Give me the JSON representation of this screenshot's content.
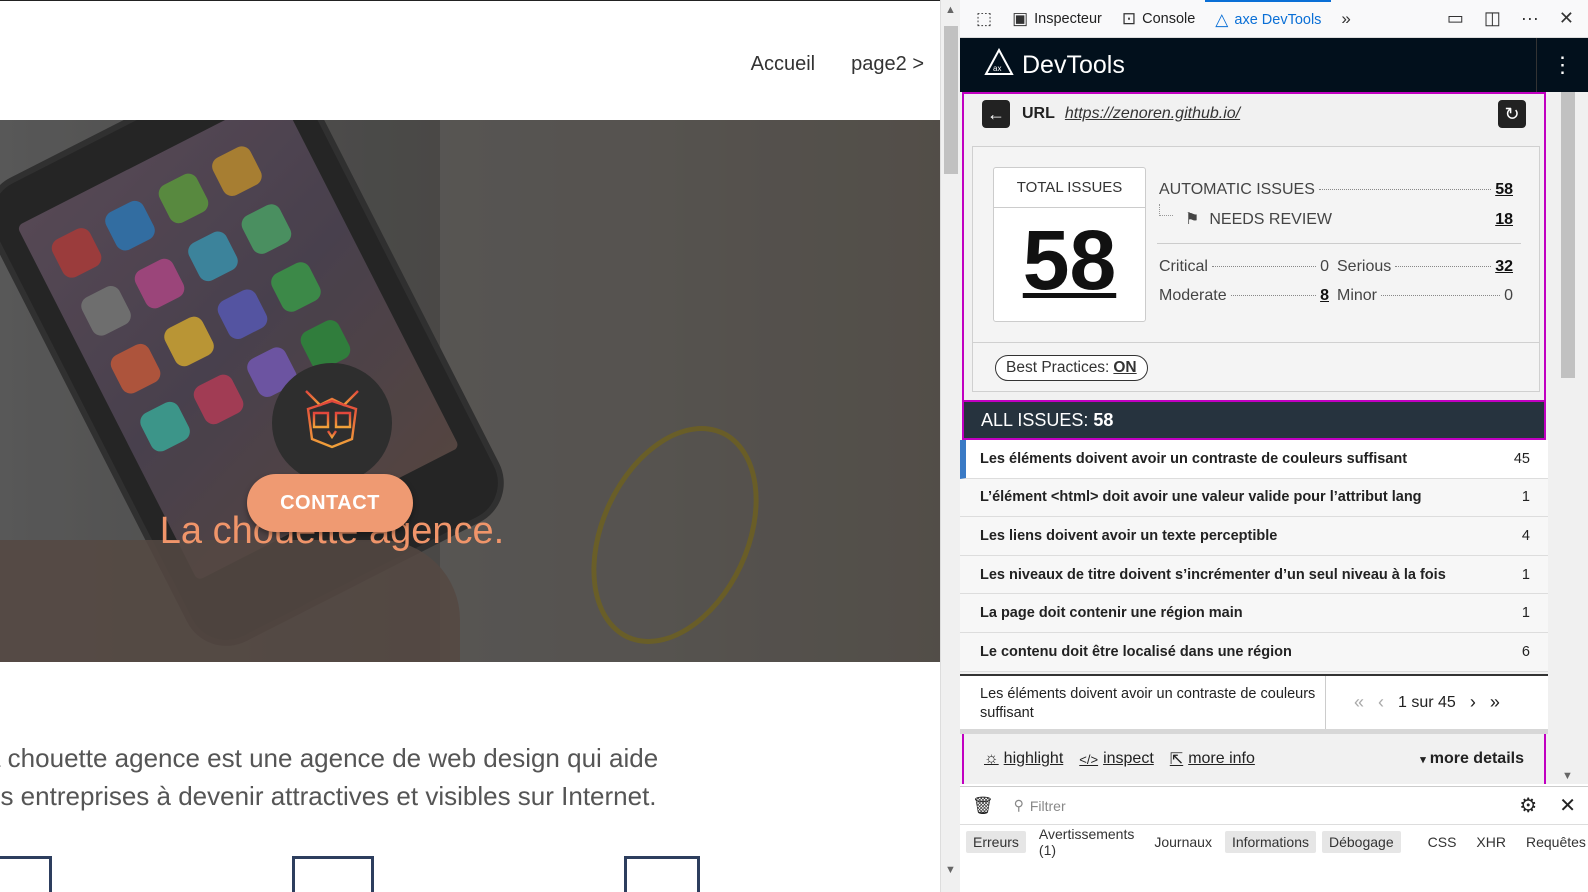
{
  "site": {
    "nav": [
      "Accueil",
      "page2 >"
    ],
    "hero_title": "La chouette agence.",
    "contact_label": "CONTACT",
    "body_line1": "a chouette agence est une agence de web design qui aide",
    "body_line2": "es entreprises à devenir attractives et visibles sur Internet."
  },
  "toolbar": {
    "tabs": [
      {
        "label": "Inspecteur",
        "icon": "inspector-icon"
      },
      {
        "label": "Console",
        "icon": "console-icon"
      },
      {
        "label": "axe DevTools",
        "icon": "axe-icon",
        "active": true
      }
    ]
  },
  "axe": {
    "header_title": "DevTools",
    "url_label": "URL",
    "url_value": "https://zenoren.github.io/",
    "total_label": "TOTAL ISSUES",
    "total_value": "58",
    "automatic_label": "AUTOMATIC ISSUES",
    "automatic_value": "58",
    "needs_review_label": "NEEDS REVIEW",
    "needs_review_value": "18",
    "critical_label": "Critical",
    "critical_value": "0",
    "serious_label": "Serious",
    "serious_value": "32",
    "moderate_label": "Moderate",
    "moderate_value": "8",
    "minor_label": "Minor",
    "minor_value": "0",
    "best_practices_label": "Best Practices:",
    "best_practices_value": "ON",
    "all_issues_label": "ALL ISSUES:",
    "all_issues_value": "58",
    "issues": [
      {
        "title": "Les éléments doivent avoir un contraste de couleurs suffisant",
        "count": "45"
      },
      {
        "title": "L’élément <html> doit avoir une valeur valide pour l’attribut lang",
        "count": "1"
      },
      {
        "title": "Les liens doivent avoir un texte perceptible",
        "count": "4"
      },
      {
        "title": "Les niveaux de titre doivent s’incrémenter d’un seul niveau à la fois",
        "count": "1"
      },
      {
        "title": "La page doit contenir une région main",
        "count": "1"
      },
      {
        "title": "Le contenu doit être localisé dans une région",
        "count": "6"
      }
    ],
    "detail_title": "Les éléments doivent avoir un contraste de couleurs suffisant",
    "pager_text": "1 sur 45",
    "highlight_label": "highlight",
    "inspect_label": "inspect",
    "more_info_label": "more info",
    "more_details_label": "more details"
  },
  "console": {
    "filter_placeholder": "Filtrer",
    "tabs": [
      {
        "label": "Erreurs",
        "on": true
      },
      {
        "label": "Avertissements (1)",
        "on": false
      },
      {
        "label": "Journaux",
        "on": false
      },
      {
        "label": "Informations",
        "on": true
      },
      {
        "label": "Débogage",
        "on": true
      },
      {
        "label": "CSS",
        "on": false
      },
      {
        "label": "XHR",
        "on": false
      },
      {
        "label": "Requêtes",
        "on": false
      }
    ]
  },
  "colors": {
    "accent": "#0a6fd6",
    "axe_header": "#02101c",
    "focus_outline": "#c100c1",
    "hero_accent": "#f0956a"
  }
}
